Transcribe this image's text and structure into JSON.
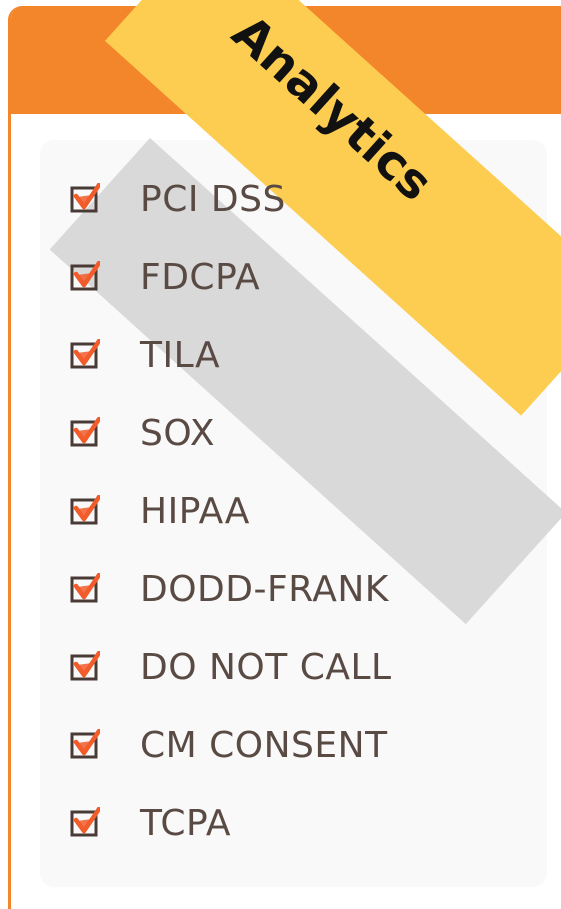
{
  "ribbon": {
    "label": "Analytics",
    "color": "#fccd50"
  },
  "theme": {
    "header_color": "#f3852a",
    "check_color": "#f25c2b",
    "box_color": "#4a3a36",
    "text_color": "#5a4a44"
  },
  "compliance_list": {
    "items": [
      {
        "label": "PCI DSS",
        "checked": true
      },
      {
        "label": "FDCPA",
        "checked": true
      },
      {
        "label": "TILA",
        "checked": true
      },
      {
        "label": "SOX",
        "checked": true
      },
      {
        "label": "HIPAA",
        "checked": true
      },
      {
        "label": "DODD-FRANK",
        "checked": true
      },
      {
        "label": "DO NOT CALL",
        "checked": true
      },
      {
        "label": "CM CONSENT",
        "checked": true
      },
      {
        "label": "TCPA",
        "checked": true
      }
    ]
  }
}
